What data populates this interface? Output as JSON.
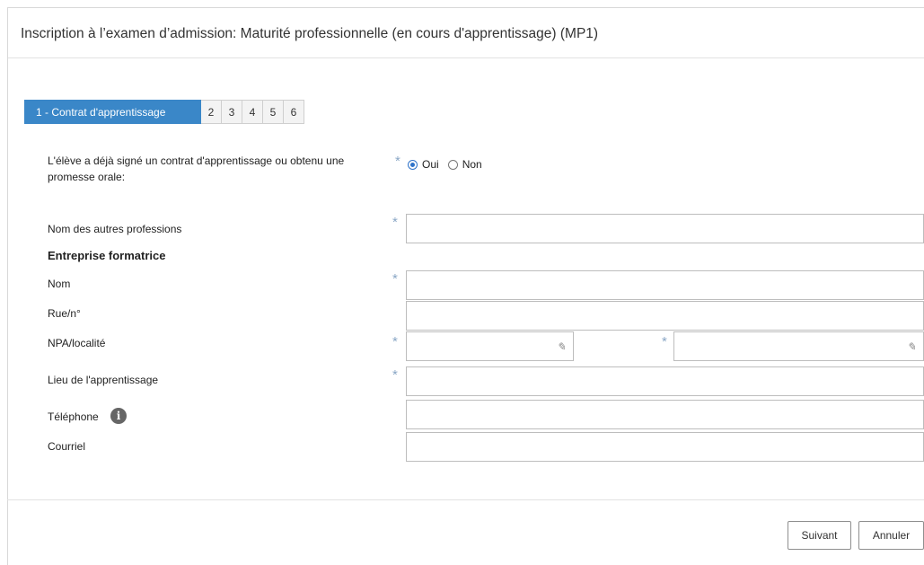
{
  "dialog": {
    "title": "Inscription à l’examen d’admission: Maturité professionnelle (en cours d'apprentissage) (MP1)"
  },
  "wizard": {
    "steps": [
      {
        "label": "1 - Contrat d'apprentissage",
        "active": true
      },
      {
        "label": "2",
        "active": false
      },
      {
        "label": "3",
        "active": false
      },
      {
        "label": "4",
        "active": false
      },
      {
        "label": "5",
        "active": false
      },
      {
        "label": "6",
        "active": false
      }
    ]
  },
  "form": {
    "required_marker": "*",
    "contract_question": "L'élève a déjà signé un contrat d'apprentissage ou obtenu une promesse orale:",
    "contract_options": [
      {
        "label": "Oui",
        "selected": true
      },
      {
        "label": "Non",
        "selected": false
      }
    ],
    "other_professions": {
      "label": "Nom des autres professions",
      "value": ""
    },
    "section_company": "Entreprise formatrice",
    "name": {
      "label": "Nom",
      "value": ""
    },
    "street": {
      "label": "Rue/n°",
      "value": ""
    },
    "postcode_city": {
      "label": "NPA/localité",
      "postcode_value": "",
      "city_value": ""
    },
    "training_place": {
      "label": "Lieu de l'apprentissage",
      "value": ""
    },
    "phone": {
      "label": "Téléphone",
      "value": ""
    },
    "email": {
      "label": "Courriel",
      "value": ""
    }
  },
  "footer": {
    "next_label": "Suivant",
    "cancel_label": "Annuler"
  },
  "colors": {
    "accent": "#3a87c8",
    "required_marker": "#8aa7c6",
    "radio_selected": "#2f73c9"
  },
  "icons": {
    "info": "info-icon",
    "edit": "pencil-icon"
  }
}
